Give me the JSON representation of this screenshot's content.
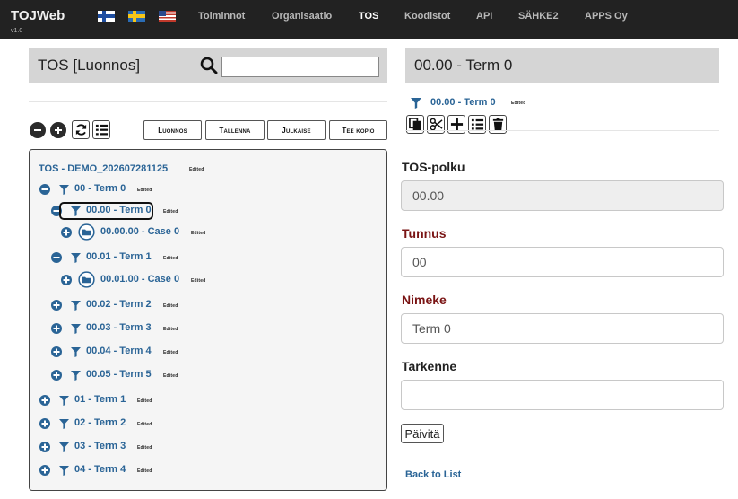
{
  "navbar": {
    "brand": "TOJWeb",
    "version": "v1.0",
    "flags": [
      "finnish-flag",
      "swedish-flag",
      "us-flag"
    ],
    "links": [
      "Toiminnot",
      "Organisaatio",
      "TOS",
      "Koodistot",
      "API",
      "SÄHKE2",
      "APPS Oy"
    ],
    "active": "TOS"
  },
  "left": {
    "title": "TOS [Luonnos]",
    "search_placeholder": "",
    "toolbar_icons": [
      "collapse-all-icon",
      "expand-all-icon",
      "refresh-icon",
      "list-icon"
    ],
    "buttons": [
      "Luonnos",
      "Tallenna",
      "Julkaise",
      "Tee kopio"
    ]
  },
  "tree": {
    "root": "TOS - DEMO_202607281125",
    "edited": "Edited",
    "nodes": [
      {
        "label": "00 - Term 0",
        "level": 1,
        "toggle": "minus",
        "kind": "filter"
      },
      {
        "label": "00.00 - Term 0",
        "level": 2,
        "toggle": "minus",
        "kind": "filter",
        "selected": true
      },
      {
        "label": "00.00.00 - Case 0",
        "level": 3,
        "toggle": "plus",
        "kind": "folder"
      },
      {
        "label": "00.01 - Term 1",
        "level": 2,
        "toggle": "minus",
        "kind": "filter"
      },
      {
        "label": "00.01.00 - Case 0",
        "level": 3,
        "toggle": "plus",
        "kind": "folder"
      },
      {
        "label": "00.02 - Term 2",
        "level": 2,
        "toggle": "plus",
        "kind": "filter"
      },
      {
        "label": "00.03 - Term 3",
        "level": 2,
        "toggle": "plus",
        "kind": "filter"
      },
      {
        "label": "00.04 - Term 4",
        "level": 2,
        "toggle": "plus",
        "kind": "filter"
      },
      {
        "label": "00.05 - Term 5",
        "level": 2,
        "toggle": "plus",
        "kind": "filter"
      },
      {
        "label": "01 - Term 1",
        "level": 1,
        "toggle": "plus",
        "kind": "filter"
      },
      {
        "label": "02 - Term 2",
        "level": 1,
        "toggle": "plus",
        "kind": "filter"
      },
      {
        "label": "03 - Term 3",
        "level": 1,
        "toggle": "plus",
        "kind": "filter"
      },
      {
        "label": "04 - Term 4",
        "level": 1,
        "toggle": "plus",
        "kind": "filter"
      }
    ]
  },
  "right": {
    "title": "00.00 - Term 0",
    "crumb": "00.00 - Term 0",
    "edited": "Edited",
    "action_icons": [
      "copy-icon",
      "cut-icon",
      "add-icon",
      "list-icon",
      "delete-icon"
    ],
    "fields": {
      "tos_path_label": "TOS-polku",
      "tos_path_value": "00.00",
      "code_label": "Tunnus",
      "code_value": "00",
      "name_label": "Nimeke",
      "name_value": "Term 0",
      "spec_label": "Tarkenne",
      "spec_value": ""
    },
    "update_button": "Päivitä",
    "back_link": "Back to List"
  },
  "colors": {
    "navbar_bg": "#222222",
    "link_blue": "#2a6496",
    "required_label": "#7a1414",
    "panel_gray": "#d5d5d5"
  }
}
